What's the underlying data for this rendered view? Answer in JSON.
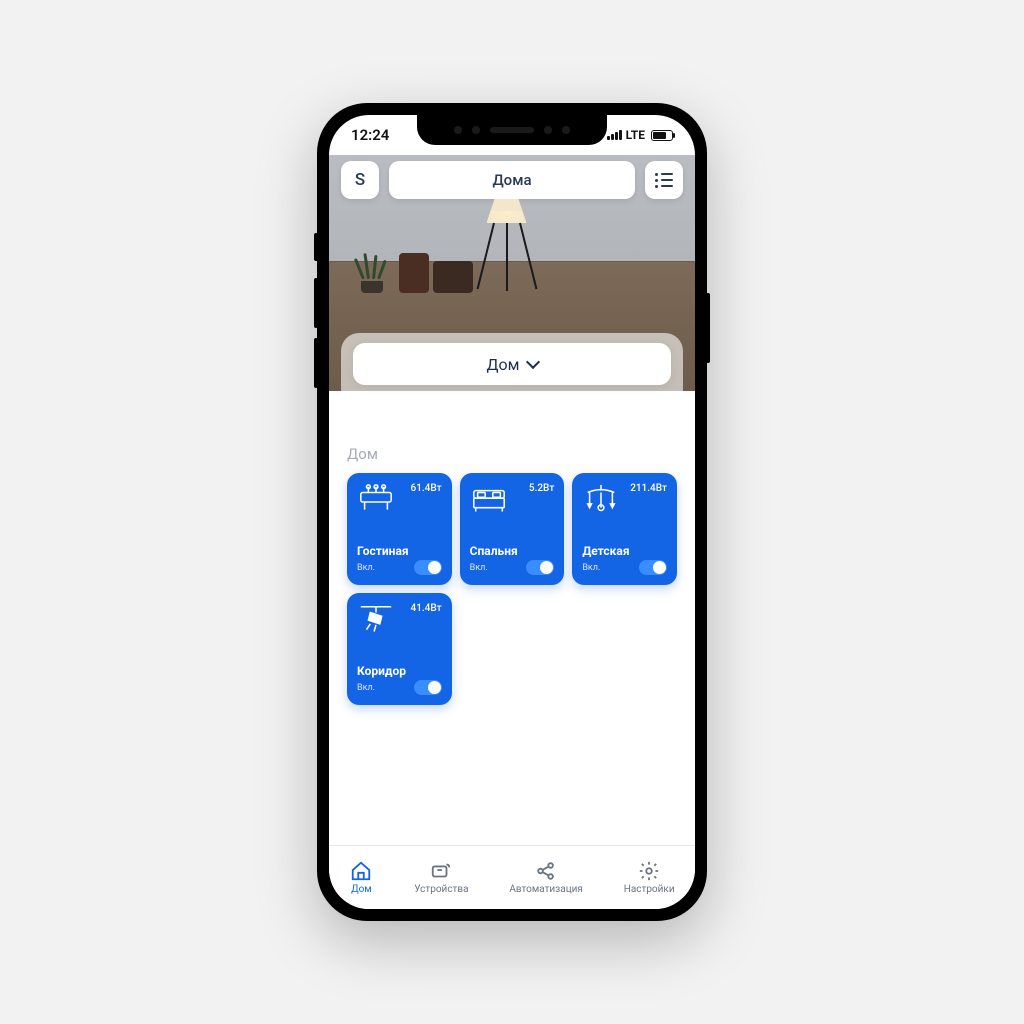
{
  "status": {
    "time": "12:24",
    "net": "LTE"
  },
  "header": {
    "avatar_letter": "S",
    "home_label": "Дома"
  },
  "dropdown": {
    "label": "Дом"
  },
  "section": {
    "title": "Дом"
  },
  "rooms": [
    {
      "name": "Гостиная",
      "watt": "61.4Вт",
      "state": "Вкл.",
      "icon": "foosball"
    },
    {
      "name": "Спальня",
      "watt": "5.2Вт",
      "state": "Вкл.",
      "icon": "bed"
    },
    {
      "name": "Детская",
      "watt": "211.4Вт",
      "state": "Вкл.",
      "icon": "mobile-toy"
    },
    {
      "name": "Коридор",
      "watt": "41.4Вт",
      "state": "Вкл.",
      "icon": "spotlight"
    }
  ],
  "tabs": {
    "home": "Дом",
    "devices": "Устройства",
    "automation": "Автоматизация",
    "settings": "Настройки"
  },
  "colors": {
    "accent": "#1464e6"
  }
}
